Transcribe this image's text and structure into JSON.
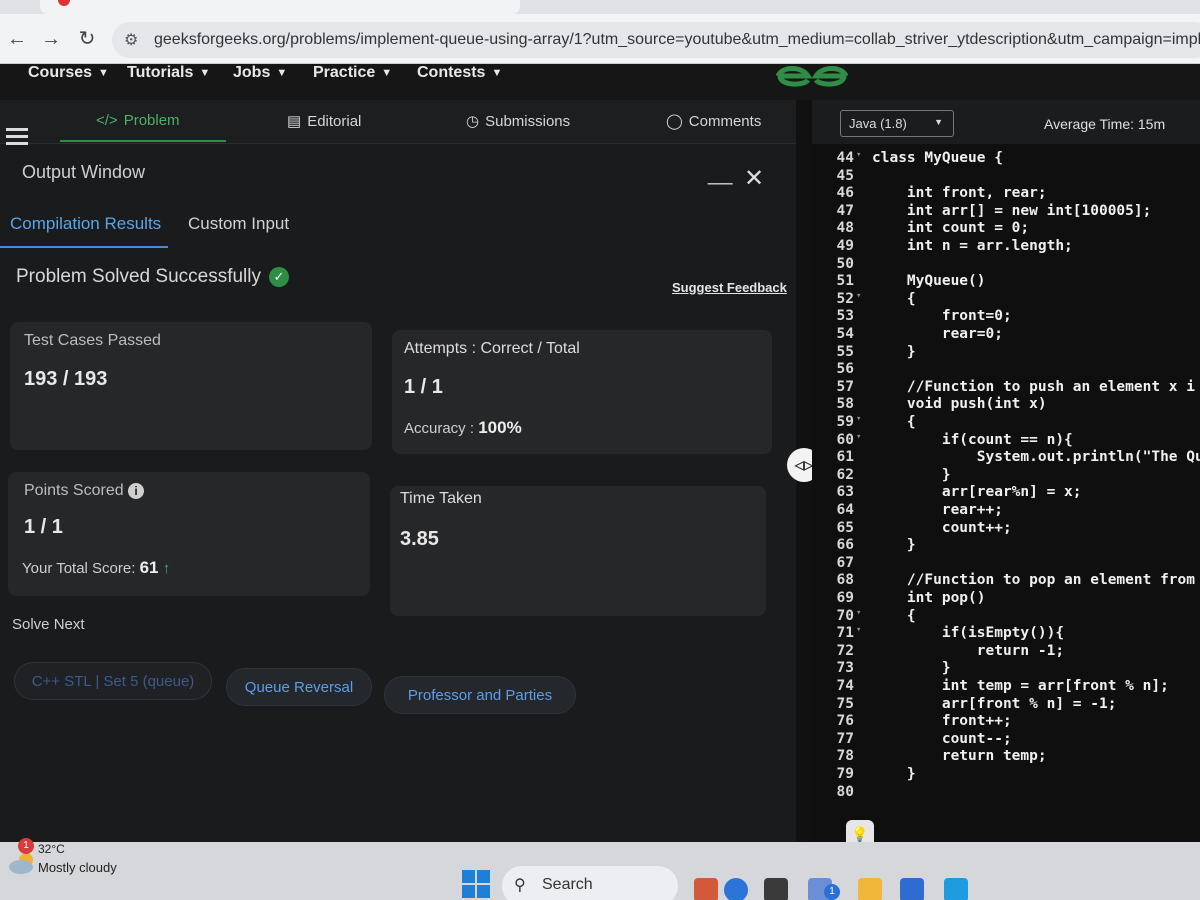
{
  "browser": {
    "url": "geeksforgeeks.org/problems/implement-queue-using-array/1?utm_source=youtube&utm_medium=collab_striver_ytdescription&utm_campaign=implem",
    "back": "←",
    "forward": "→",
    "reload": "↻"
  },
  "gfgnav": {
    "items": [
      "Courses",
      "Tutorials",
      "Jobs",
      "Practice",
      "Contests"
    ],
    "chevron": "⌄"
  },
  "problem_tabs": [
    {
      "label": "Problem",
      "icon": "</>"
    },
    {
      "label": "Editorial",
      "icon": "▤"
    },
    {
      "label": "Submissions",
      "icon": "◷"
    },
    {
      "label": "Comments",
      "icon": "◯"
    }
  ],
  "output": {
    "title": "Output Window",
    "minimize": "__",
    "close": "✕",
    "tabs": [
      "Compilation Results",
      "Custom Input"
    ],
    "status": "Problem Solved Successfully",
    "feedback": "Suggest Feedback",
    "test_cases_label": "Test Cases Passed",
    "test_cases_value": "193 / 193",
    "attempts_label": "Attempts : Correct / Total",
    "attempts_value": "1 / 1",
    "accuracy_label": "Accuracy :",
    "accuracy_value": "100%",
    "points_label": "Points Scored",
    "points_value": "1 / 1",
    "total_score_label": "Your Total Score:",
    "total_score_value": "61",
    "time_label": "Time Taken",
    "time_value": "3.85",
    "solve_next_label": "Solve Next",
    "solve_next": [
      "C++ STL | Set 5 (queue)",
      "Queue Reversal",
      "Professor and Parties"
    ]
  },
  "editor": {
    "language": "Java (1.8)",
    "average_time": "Average Time: 15m",
    "lines": [
      {
        "n": "44",
        "fold": true,
        "code": "class MyQueue {"
      },
      {
        "n": "45",
        "fold": false,
        "code": ""
      },
      {
        "n": "46",
        "fold": false,
        "code": "    int front, rear;"
      },
      {
        "n": "47",
        "fold": false,
        "code": "    int arr[] = new int[100005];"
      },
      {
        "n": "48",
        "fold": false,
        "code": "    int count = 0;"
      },
      {
        "n": "49",
        "fold": false,
        "code": "    int n = arr.length;"
      },
      {
        "n": "50",
        "fold": false,
        "code": ""
      },
      {
        "n": "51",
        "fold": false,
        "code": "    MyQueue()"
      },
      {
        "n": "52",
        "fold": true,
        "code": "    {"
      },
      {
        "n": "53",
        "fold": false,
        "code": "        front=0;"
      },
      {
        "n": "54",
        "fold": false,
        "code": "        rear=0;"
      },
      {
        "n": "55",
        "fold": false,
        "code": "    }"
      },
      {
        "n": "56",
        "fold": false,
        "code": ""
      },
      {
        "n": "57",
        "fold": false,
        "code": "    //Function to push an element x i"
      },
      {
        "n": "58",
        "fold": false,
        "code": "    void push(int x)"
      },
      {
        "n": "59",
        "fold": true,
        "code": "    {"
      },
      {
        "n": "60",
        "fold": true,
        "code": "        if(count == n){"
      },
      {
        "n": "61",
        "fold": false,
        "code": "            System.out.println(\"The Qu"
      },
      {
        "n": "62",
        "fold": false,
        "code": "        }"
      },
      {
        "n": "63",
        "fold": false,
        "code": "        arr[rear%n] = x;"
      },
      {
        "n": "64",
        "fold": false,
        "code": "        rear++;"
      },
      {
        "n": "65",
        "fold": false,
        "code": "        count++;"
      },
      {
        "n": "66",
        "fold": false,
        "code": "    }"
      },
      {
        "n": "67",
        "fold": false,
        "code": ""
      },
      {
        "n": "68",
        "fold": false,
        "code": "    //Function to pop an element from"
      },
      {
        "n": "69",
        "fold": false,
        "code": "    int pop()"
      },
      {
        "n": "70",
        "fold": true,
        "code": "    {"
      },
      {
        "n": "71",
        "fold": true,
        "code": "        if(isEmpty()){"
      },
      {
        "n": "72",
        "fold": false,
        "code": "            return -1;"
      },
      {
        "n": "73",
        "fold": false,
        "code": "        }"
      },
      {
        "n": "74",
        "fold": false,
        "code": "        int temp = arr[front % n];"
      },
      {
        "n": "75",
        "fold": false,
        "code": "        arr[front % n] = -1;"
      },
      {
        "n": "76",
        "fold": false,
        "code": "        front++;"
      },
      {
        "n": "77",
        "fold": false,
        "code": "        count--;"
      },
      {
        "n": "78",
        "fold": false,
        "code": "        return temp;"
      },
      {
        "n": "79",
        "fold": false,
        "code": "    }"
      },
      {
        "n": "80",
        "fold": false,
        "code": ""
      }
    ]
  },
  "taskbar": {
    "weather_badge": "1",
    "temperature": "32°C",
    "condition": "Mostly cloudy",
    "search": "Search",
    "app_badge": "1"
  },
  "colors": {
    "gfg_green": "#2f8d46",
    "link_blue": "#5b9ee9",
    "success": "#2f8d46"
  }
}
